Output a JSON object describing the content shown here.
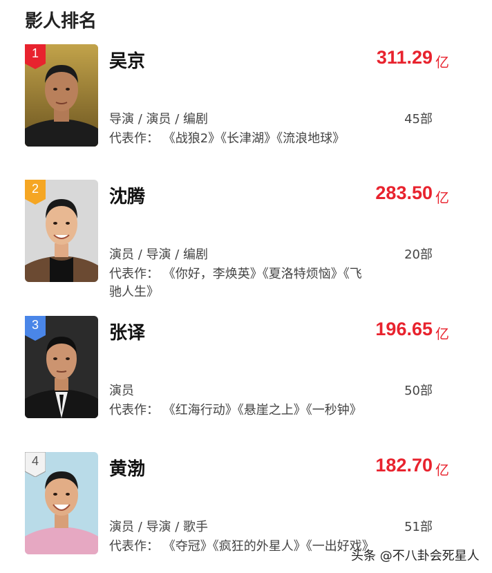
{
  "page_title": "影人排名",
  "watermark": "头条 @不八卦会死星人",
  "people": [
    {
      "rank": "1",
      "name": "吴京",
      "box_office": "311.29",
      "unit": "亿",
      "roles": "导演 / 演员 / 编剧",
      "film_count": "45部",
      "works": "代表作： 《战狼2》《长津湖》《流浪地球》",
      "badge_color": "#e8232e"
    },
    {
      "rank": "2",
      "name": "沈腾",
      "box_office": "283.50",
      "unit": "亿",
      "roles": "演员 / 导演 / 编剧",
      "film_count": "20部",
      "works": "代表作： 《你好，李焕英》《夏洛特烦恼》《飞驰人生》",
      "badge_color": "#f5a623"
    },
    {
      "rank": "3",
      "name": "张译",
      "box_office": "196.65",
      "unit": "亿",
      "roles": "演员",
      "film_count": "50部",
      "works": "代表作： 《红海行动》《悬崖之上》《一秒钟》",
      "badge_color": "#4a86e8"
    },
    {
      "rank": "4",
      "name": "黄渤",
      "box_office": "182.70",
      "unit": "亿",
      "roles": "演员 / 导演 / 歌手",
      "film_count": "51部",
      "works": "代表作： 《夺冠》《疯狂的外星人》《一出好戏》",
      "badge_color": "#f2f2f2"
    }
  ]
}
